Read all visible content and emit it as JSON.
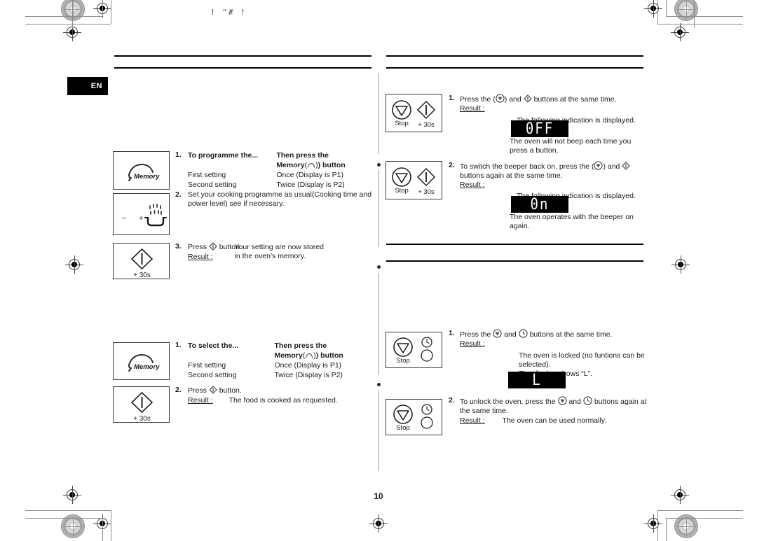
{
  "document": {
    "language_badge": "EN",
    "page_number": "10",
    "top_artifact_text": "!  \"# !"
  },
  "left_column": {
    "section_memory_programme": {
      "steps": [
        {
          "number": "1.",
          "table": {
            "headers": [
              "To programme the...",
              "Then press the\nMemory(⌒) button"
            ],
            "header_col1": "To programme the...",
            "header_col2_line1": "Then press the",
            "header_col2_line2_prefix": "Memory",
            "header_col2_line2_suffix": ") button",
            "rows": [
              {
                "setting": "First setting",
                "action": "Once (Display is P1)"
              },
              {
                "setting": "Second setting",
                "action": "Twice (Display is P2)"
              }
            ]
          },
          "icon_box": {
            "name": "memory-button",
            "label": "Memory"
          }
        },
        {
          "number": "2.",
          "text": "Set your cooking programme as usual(Cooking time and power level) see if necessary.",
          "icon_box": {
            "name": "power-level-button",
            "minus": "–",
            "plus": "+"
          }
        },
        {
          "number": "3.",
          "text_before_icon": "Press",
          "text_after_icon": "button.",
          "result_label": "Result :",
          "result_text": "Your setting are now stored in the oven’s memory.",
          "icon_box": {
            "name": "start-30s-button",
            "label": "+ 30s"
          }
        }
      ]
    },
    "section_memory_recall": {
      "steps": [
        {
          "number": "1.",
          "table": {
            "header_col1": "To select the...",
            "header_col2_line1": "Then press the",
            "header_col2_line2_prefix": "Memory",
            "header_col2_line2_suffix": ") button",
            "rows": [
              {
                "setting": "First setting",
                "action": "Once (Display is P1)"
              },
              {
                "setting": "Second setting",
                "action": "Twice (Display is P2)"
              }
            ]
          },
          "icon_box": {
            "name": "memory-button",
            "label": "Memory"
          }
        },
        {
          "number": "2.",
          "text_before_icon": "Press",
          "text_after_icon": "button.",
          "result_label": "Result :",
          "result_text": "The food is cooked as requested.",
          "icon_box": {
            "name": "start-30s-button",
            "label": "+ 30s"
          }
        }
      ]
    }
  },
  "right_column": {
    "section_beeper": {
      "steps": [
        {
          "number": "1.",
          "text_a": "Press the (",
          "text_b": ") and",
          "text_c": "buttons at the same time.",
          "result_label": "Result :",
          "result_intro": "The following indication is displayed.",
          "display_value": "0FF",
          "result_text": "The oven will not beep each time you press a button.",
          "icon_box": {
            "name": "stop-and-start-buttons",
            "stop_label": "Stop",
            "start_label": "+ 30s"
          }
        },
        {
          "number": "2.",
          "line1": "To switch the beeper back on, press the (",
          "line1b": ") and",
          "line2": "buttons again at the same time.",
          "result_label": "Result :",
          "result_intro": "The following indication is displayed.",
          "display_value": "0n",
          "result_text": "The oven operates with the beeper on again.",
          "icon_box": {
            "name": "stop-and-start-buttons",
            "stop_label": "Stop",
            "start_label": "+ 30s"
          }
        }
      ]
    },
    "section_child_lock": {
      "steps": [
        {
          "number": "1.",
          "text_a": "Press the",
          "text_b": "and",
          "text_c": "buttons at the same time.",
          "result_label": "Result :",
          "result_line1": "The oven is locked (no funtions can be selected).",
          "result_line2": "The display shows “L”.",
          "display_value": "L",
          "icon_box": {
            "name": "stop-and-clock-buttons",
            "stop_label": "Stop"
          }
        },
        {
          "number": "2.",
          "line1a": "To unlock the oven, press the",
          "line1b": "and",
          "line1c": "buttons again at",
          "line2": "the same time.",
          "result_label": "Result :",
          "result_text": "The oven can be used normally.",
          "icon_box": {
            "name": "stop-and-clock-buttons",
            "stop_label": "Stop"
          }
        }
      ]
    }
  },
  "colors": {
    "ink": "#1a1a1a",
    "rule": "#000000",
    "lcd_background": "#000000",
    "lcd_text": "#ffffff",
    "badge_background": "#000000"
  }
}
